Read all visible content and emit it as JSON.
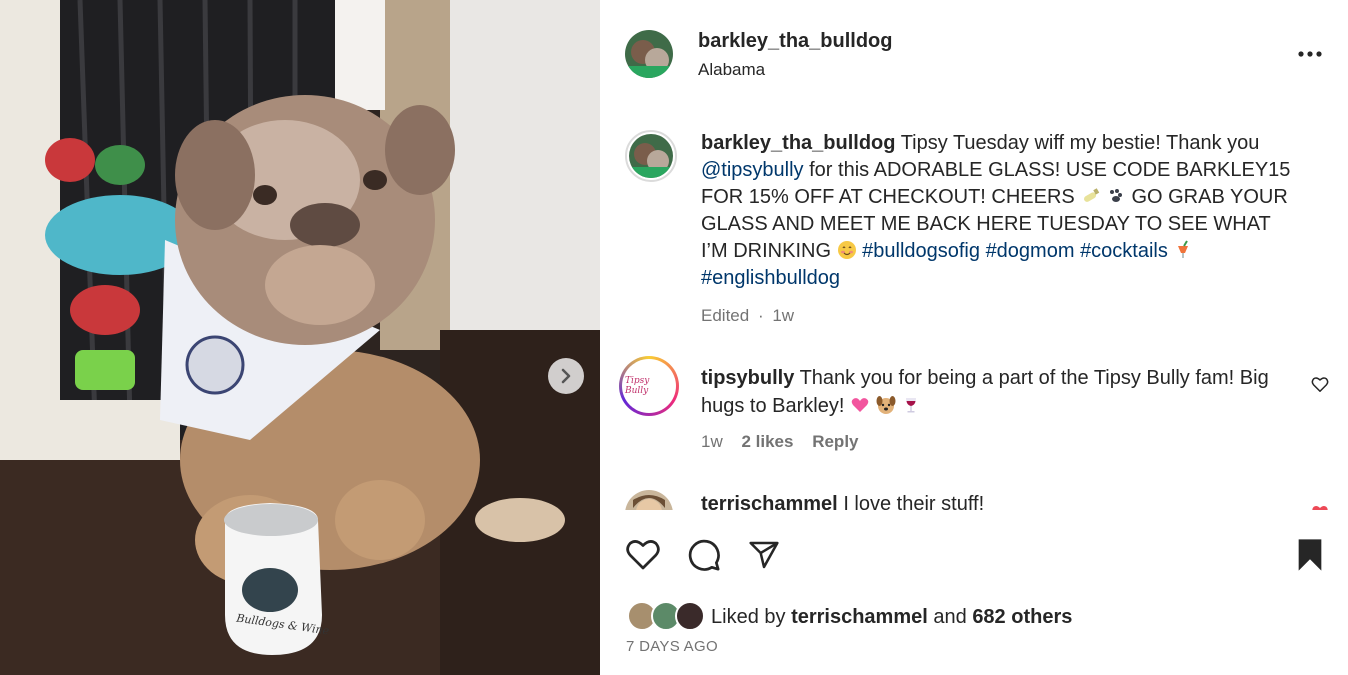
{
  "post": {
    "username": "barkley_tha_bulldog",
    "location": "Alabama"
  },
  "caption": {
    "username": "barkley_tha_bulldog",
    "text_1": "Tipsy Tuesday wiff my bestie! Thank you",
    "mention": "@tipsybully",
    "text_2": "for this ADORABLE GLASS! USE CODE BARKLEY15 FOR 15% OFF AT CHECKOUT! CHEERS",
    "text_3": "GO GRAB YOUR GLASS AND MEET ME BACK HERE TUESDAY TO SEE WHAT I’M DRINKING",
    "hashtags": [
      "#bulldogsofig",
      "#dogmom",
      "#cocktails",
      "#englishbulldog"
    ],
    "meta": {
      "edited": "Edited",
      "sep": "·",
      "age": "1w"
    }
  },
  "comments": [
    {
      "username": "tipsybully",
      "text": "Thank you for being a part of the Tipsy Bully fam! Big hugs to Barkley!",
      "age": "1w",
      "likes": "2 likes",
      "reply": "Reply",
      "avatar_text": "Tipsy Bully"
    },
    {
      "username": "terrischammel",
      "text": "I love their stuff!"
    }
  ],
  "glass_text": "Bulldogs & Wine",
  "likes": {
    "prefix": "Liked by",
    "user": "terrischammel",
    "and": "and",
    "others": "682 others"
  },
  "date": "7 DAYS AGO",
  "icons": {
    "more": "more-options-icon",
    "next": "chevron-right-icon",
    "heart": "heart-icon",
    "comment": "comment-icon",
    "share": "share-icon",
    "save": "bookmark-icon"
  },
  "colors": {
    "link": "#00376b",
    "muted": "#737373",
    "text": "#262626"
  }
}
